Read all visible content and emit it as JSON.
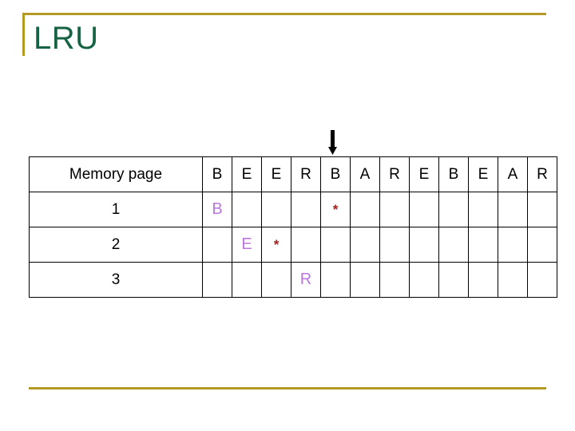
{
  "slide": {
    "title": "LRU",
    "title_color": "#156343",
    "rule_color": "#b39a22"
  },
  "pointer": {
    "icon": "down-arrow-icon",
    "points_to_column_index": 4
  },
  "table": {
    "header_label": "Memory page",
    "reference_string": [
      "B",
      "E",
      "E",
      "R",
      "B",
      "A",
      "R",
      "E",
      "B",
      "E",
      "A",
      "R"
    ],
    "letter_color": "#bb77dd",
    "mark_color": "#a02020",
    "mark_glyph": "*",
    "rows": [
      {
        "label": "1",
        "cells": [
          "B",
          "",
          "",
          "",
          "*",
          "",
          "",
          "",
          "",
          "",
          "",
          ""
        ]
      },
      {
        "label": "2",
        "cells": [
          "",
          "E",
          "*",
          "",
          "",
          "",
          "",
          "",
          "",
          "",
          "",
          ""
        ]
      },
      {
        "label": "3",
        "cells": [
          "",
          "",
          "",
          "R",
          "",
          "",
          "",
          "",
          "",
          "",
          "",
          ""
        ]
      }
    ]
  }
}
